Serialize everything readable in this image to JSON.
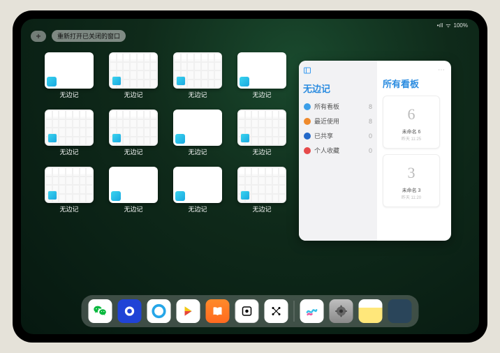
{
  "status": {
    "signal": "•ıll",
    "wifi": "ᯤ",
    "battery": "100%"
  },
  "topbar": {
    "plus": "+",
    "reopen": "重新打开已关闭的窗口"
  },
  "app_windows": [
    {
      "label": "无边记",
      "type": "blank"
    },
    {
      "label": "无边记",
      "type": "cal"
    },
    {
      "label": "无边记",
      "type": "cal"
    },
    {
      "label": "无边记",
      "type": "blank"
    },
    {
      "label": "无边记",
      "type": "cal"
    },
    {
      "label": "无边记",
      "type": "cal"
    },
    {
      "label": "无边记",
      "type": "blank"
    },
    {
      "label": "无边记",
      "type": "cal"
    },
    {
      "label": "无边记",
      "type": "cal"
    },
    {
      "label": "无边记",
      "type": "blank"
    },
    {
      "label": "无边记",
      "type": "blank"
    },
    {
      "label": "无边记",
      "type": "cal"
    }
  ],
  "panel": {
    "left_title": "无边记",
    "menu": [
      {
        "label": "所有看板",
        "count": "8",
        "color": "c-blue"
      },
      {
        "label": "最近使用",
        "count": "8",
        "color": "c-orange"
      },
      {
        "label": "已共享",
        "count": "0",
        "color": "c-dblue"
      },
      {
        "label": "个人收藏",
        "count": "0",
        "color": "c-red"
      }
    ],
    "right_title": "所有看板",
    "boards": [
      {
        "glyph": "6",
        "label": "未命名 6",
        "sub": "昨天 11:25"
      },
      {
        "glyph": "3",
        "label": "未命名 3",
        "sub": "昨天 11:20"
      }
    ]
  },
  "dock": [
    {
      "name": "wechat-icon"
    },
    {
      "name": "quark-icon"
    },
    {
      "name": "qq-browser-icon"
    },
    {
      "name": "play-icon"
    },
    {
      "name": "books-icon"
    },
    {
      "name": "widget-icon"
    },
    {
      "name": "grid-icon"
    },
    {
      "name": "freeform-icon"
    },
    {
      "name": "settings-icon"
    },
    {
      "name": "notes-icon"
    },
    {
      "name": "app-folder-icon"
    }
  ]
}
